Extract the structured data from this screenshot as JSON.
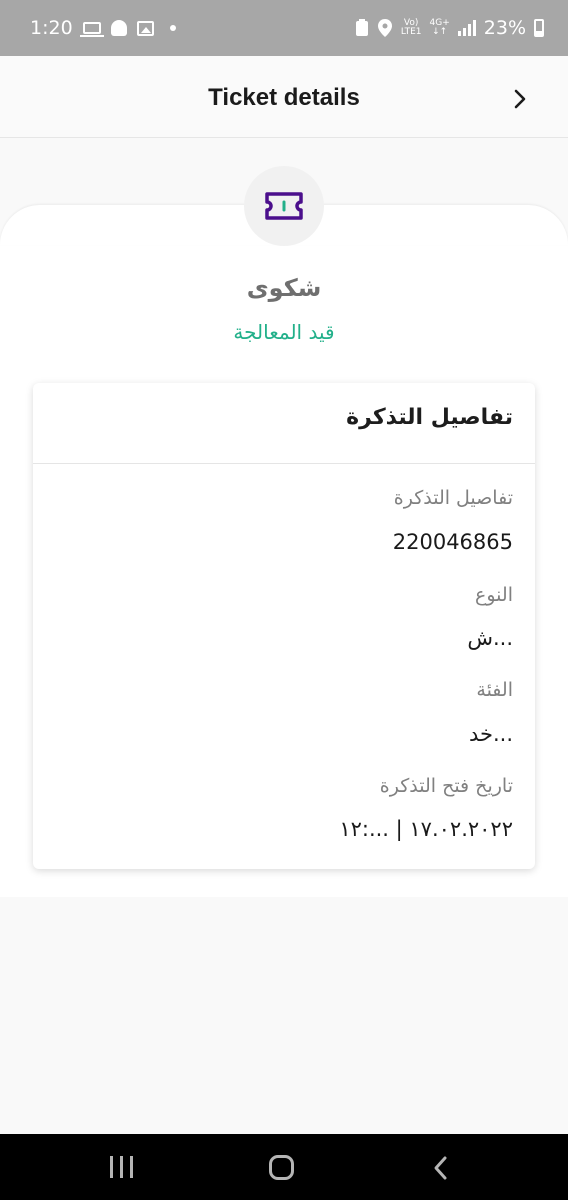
{
  "status_bar": {
    "time": "1:20",
    "network_top": "Vo)",
    "network_bottom": "LTE1",
    "net_type": "4G+",
    "battery": "23%"
  },
  "header": {
    "title": "Ticket details",
    "back_icon": "chevron-right-icon"
  },
  "ticket": {
    "icon": "ticket-icon",
    "type": "شكوى",
    "status": "قيد المعالجة",
    "status_color": "#22b08a"
  },
  "details": {
    "title": "تفاصيل التذكرة",
    "fields": [
      {
        "label": "تفاصيل التذكرة",
        "value": "220046865"
      },
      {
        "label": "النوع",
        "value": "ش..."
      },
      {
        "label": "الفئة",
        "value": "خد..."
      },
      {
        "label": "تاريخ فتح التذكرة",
        "value": "١٧.٠٢.٢٠٢٢ | ...:١٢"
      }
    ]
  },
  "colors": {
    "accent": "#4b0f8c",
    "status_green": "#22b08a"
  }
}
